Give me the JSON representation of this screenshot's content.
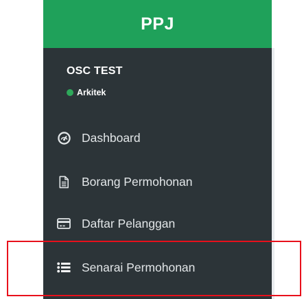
{
  "brand": {
    "title": "PPJ"
  },
  "user": {
    "name": "OSC TEST",
    "role": "Arkitek",
    "status_color": "#2ea85a"
  },
  "colors": {
    "brand_bg": "#1fa15a",
    "sidebar_bg": "#2c3438",
    "highlight": "#e8101b"
  },
  "sidebar": {
    "items": [
      {
        "label": "Dashboard",
        "icon": "dashboard-gauge-icon"
      },
      {
        "label": "Borang Permohonan",
        "icon": "document-icon"
      },
      {
        "label": "Daftar Pelanggan",
        "icon": "credit-card-icon"
      },
      {
        "label": "Senarai Permohonan",
        "icon": "list-icon"
      }
    ]
  }
}
